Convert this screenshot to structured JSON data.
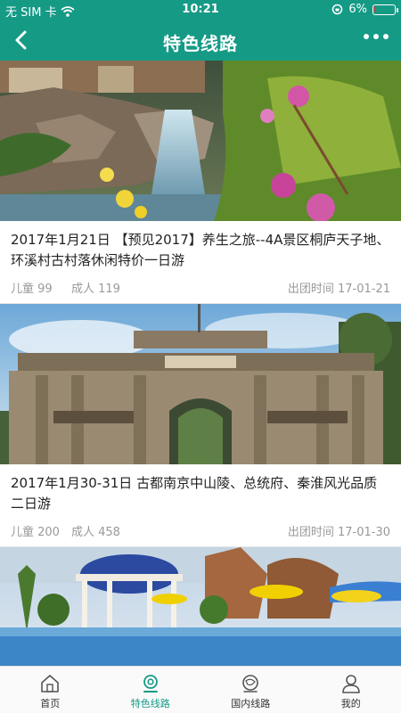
{
  "status_bar": {
    "carrier": "无 SIM 卡",
    "time": "10:21",
    "battery_percent": "6%",
    "battery_level": 0.06,
    "battery_color": "#e53935"
  },
  "header": {
    "title": "特色线路",
    "back_icon": "chevron-left-icon",
    "more_icon": "more-dots-icon"
  },
  "theme": {
    "accent": "#159a86"
  },
  "routes": [
    {
      "title": "2017年1月21日 【预见2017】养生之旅--4A景区桐庐天子地、环溪村古村落休闲特价一日游",
      "child_price": "儿童 99",
      "adult_price": "成人 119",
      "departure": "出团时间 17-01-21",
      "image_desc": "waterfall-garden"
    },
    {
      "title": "2017年1月30-31日 古都南京中山陵、总统府、秦淮风光品质二日游",
      "child_price": "儿童 200",
      "adult_price": "成人 458",
      "departure": "出团时间 17-01-30",
      "image_desc": "presidential-palace-gate"
    },
    {
      "title": "",
      "child_price": "",
      "adult_price": "",
      "departure": "",
      "image_desc": "resort-pool"
    }
  ],
  "tabs": [
    {
      "label": "首页",
      "icon": "home-icon",
      "active": false
    },
    {
      "label": "特色线路",
      "icon": "featured-route-icon",
      "active": true
    },
    {
      "label": "国内线路",
      "icon": "domestic-route-icon",
      "active": false
    },
    {
      "label": "我的",
      "icon": "profile-icon",
      "active": false
    }
  ]
}
